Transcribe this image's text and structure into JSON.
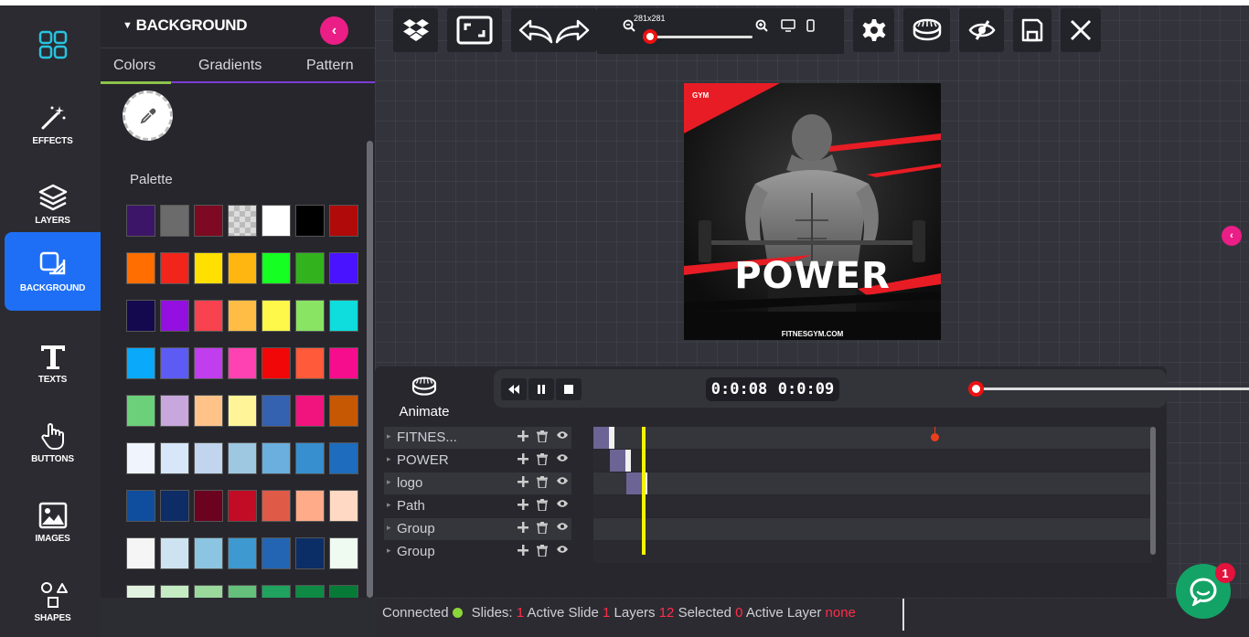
{
  "nav": {
    "items": [
      {
        "label": ""
      },
      {
        "label": "EFFECTS"
      },
      {
        "label": "LAYERS"
      },
      {
        "label": "BACKGROUND"
      },
      {
        "label": "TEXTS"
      },
      {
        "label": "BUTTONS"
      },
      {
        "label": "IMAGES"
      },
      {
        "label": "SHAPES"
      }
    ]
  },
  "panel": {
    "title": "BACKGROUND",
    "collapse_icon": "chevron-left-icon",
    "tabs": [
      "Colors",
      "Gradients",
      "Pattern"
    ],
    "active_tab": "Colors",
    "palette_label": "Palette",
    "swatches": [
      [
        "#3d1568",
        "#6b6b6b",
        "#7d0a22",
        "transparent",
        "#ffffff",
        "#000000",
        "#b00a0a"
      ],
      [
        "#ff6e00",
        "#f2251c",
        "#ffe000",
        "#ffb610",
        "#15ff22",
        "#32b31e",
        "#4a13ff"
      ],
      [
        "#14094f",
        "#9410e0",
        "#f8424f",
        "#ffbd45",
        "#fef84a",
        "#8ae464",
        "#0fdcdc"
      ],
      [
        "#0aa9f9",
        "#5c5cf5",
        "#c13eee",
        "#ff42b2",
        "#f10707",
        "#ff5a39",
        "#f50d8d"
      ],
      [
        "#6cd07a",
        "#c8a8dc",
        "#ffc38a",
        "#fff598",
        "#3462b1",
        "#f1137e",
        "#c75803"
      ],
      [
        "#eff4fd",
        "#d7e6f8",
        "#c1d5ee",
        "#9ec8e2",
        "#6aafdd",
        "#378fcf",
        "#1d6cbd"
      ],
      [
        "#0f4e9e",
        "#0e2c66",
        "#6a0220",
        "#c20c26",
        "#e05a48",
        "#ffab8a",
        "#ffd9c3"
      ],
      [
        "#f5f5f5",
        "#cde3f1",
        "#8cc5e1",
        "#3d99cf",
        "#2365b3",
        "#0b2e66",
        "#effaf0"
      ],
      [
        "#e1f3e0",
        "#c5ebc2",
        "#9ad89c",
        "#64c07a",
        "#1fa35f",
        "#0e8a45",
        "#077a37"
      ]
    ]
  },
  "toolbar": {
    "zoom_label": "281x281",
    "zoom_value": 0.03
  },
  "poster": {
    "brand": "GYM",
    "headline": "POWER",
    "url": "FITNESGYM.COM"
  },
  "timeline": {
    "animate_label": "Animate",
    "time_current": "0:0:08",
    "time_total": "0:0:09",
    "seek_value": 0.02,
    "layers": [
      {
        "name": "FITNES...",
        "bar_start": 0,
        "bar_width": 22
      },
      {
        "name": "POWER",
        "bar_start": 18,
        "bar_width": 22
      },
      {
        "name": "logo",
        "bar_start": 36,
        "bar_width": 22
      },
      {
        "name": "Path",
        "bar_start": null,
        "bar_width": 0
      },
      {
        "name": "Group",
        "bar_start": null,
        "bar_width": 0
      },
      {
        "name": "Group",
        "bar_start": null,
        "bar_width": 0
      }
    ]
  },
  "status": {
    "connected_label": "Connected",
    "slides_label": "Slides:",
    "slides": "1",
    "active_slide_label": "Active Slide",
    "active_slide": "1",
    "layers_label": "Layers",
    "layers": "12",
    "selected_label": "Selected",
    "selected": "0",
    "active_layer_label": "Active Layer",
    "active_layer": "none"
  },
  "chat": {
    "badge": "1"
  },
  "colors": {
    "accent_blue": "#1e6ff5",
    "accent_pink": "#ea1e86",
    "playhead": "#f4f400",
    "status_red": "#ff2d4a"
  }
}
